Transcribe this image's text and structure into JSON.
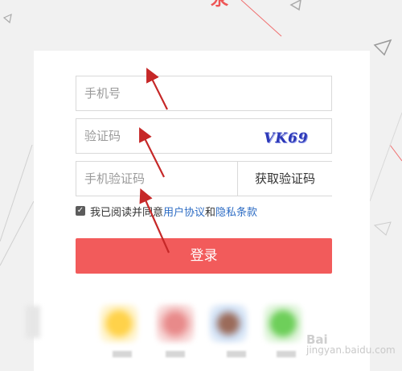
{
  "colors": {
    "accent": "#f25b5b",
    "link": "#2d6cc4",
    "annotation_arrow": "#c62828"
  },
  "header": {
    "partial_title_glyph": "汞"
  },
  "form": {
    "phone_placeholder": "手机号",
    "captcha_placeholder": "验证码",
    "captcha_image_text": "VK69",
    "sms_placeholder": "手机验证码",
    "get_code_label": "获取验证码",
    "agree": {
      "checked": true,
      "prefix": "我已阅读并同意",
      "terms_link": "用户协议",
      "conjunction": "和",
      "privacy_link": "隐私条款"
    },
    "login_label": "登录"
  },
  "social_icons": [
    "yellow-app-icon",
    "red-app-icon",
    "blue-app-icon",
    "green-app-icon"
  ],
  "watermark": {
    "line1": "Bai",
    "line2": "jingyan.baidu.com"
  }
}
